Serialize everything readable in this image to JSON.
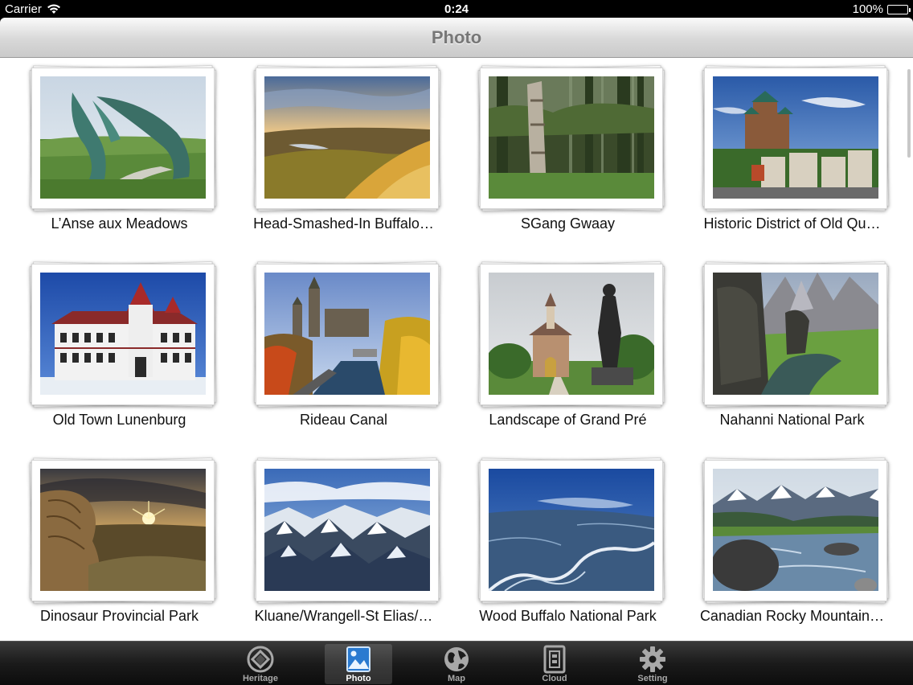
{
  "status_bar": {
    "carrier": "Carrier",
    "time": "0:24",
    "battery": "100%"
  },
  "nav": {
    "title": "Photo"
  },
  "photos": [
    {
      "caption": "L’Anse aux Meadows",
      "scene": "sculpture"
    },
    {
      "caption": "Head-Smashed-In Buffalo…",
      "scene": "prairie"
    },
    {
      "caption": "SGang Gwaay",
      "scene": "totem"
    },
    {
      "caption": "Historic District of Old Qu…",
      "scene": "chateau"
    },
    {
      "caption": "Old Town Lunenburg",
      "scene": "school"
    },
    {
      "caption": "Rideau Canal",
      "scene": "canal"
    },
    {
      "caption": "Landscape of Grand Pré",
      "scene": "church"
    },
    {
      "caption": "Nahanni National Park",
      "scene": "nahanni"
    },
    {
      "caption": "Dinosaur Provincial Park",
      "scene": "badlands"
    },
    {
      "caption": "Kluane/Wrangell-St Elias/…",
      "scene": "mountains"
    },
    {
      "caption": "Wood Buffalo National Park",
      "scene": "river"
    },
    {
      "caption": "Canadian Rocky Mountain…",
      "scene": "rockies"
    }
  ],
  "tabs": [
    {
      "label": "Heritage",
      "icon": "heritage-icon",
      "active": false
    },
    {
      "label": "Photo",
      "icon": "photo-icon",
      "active": true
    },
    {
      "label": "Map",
      "icon": "globe-icon",
      "active": false
    },
    {
      "label": "Cloud",
      "icon": "cloud-icon",
      "active": false
    },
    {
      "label": "Setting",
      "icon": "gear-icon",
      "active": false
    }
  ]
}
